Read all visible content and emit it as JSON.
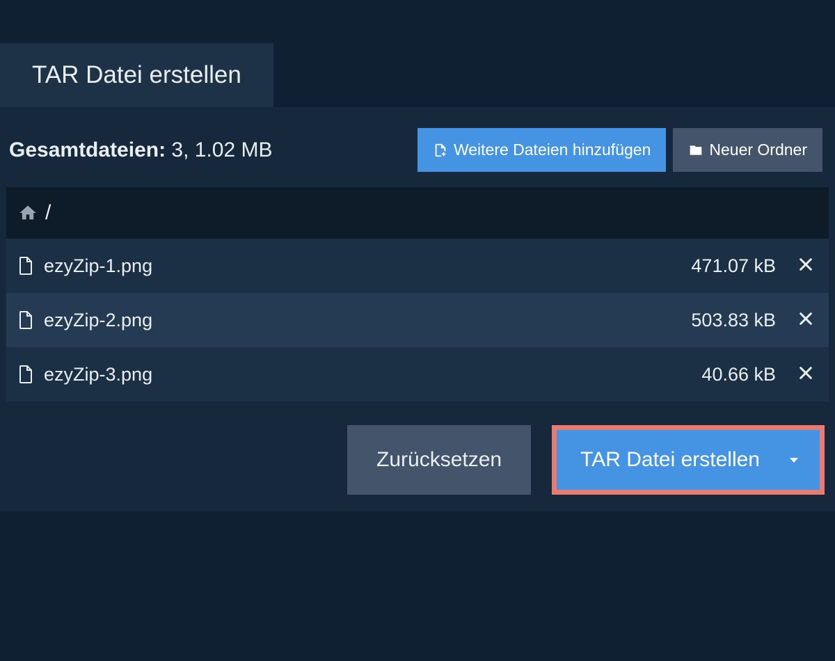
{
  "tab": {
    "title": "TAR Datei erstellen"
  },
  "summary": {
    "label": "Gesamtdateien:",
    "value": "3, 1.02 MB"
  },
  "toolbar": {
    "add_files_label": "Weitere Dateien hinzufügen",
    "new_folder_label": "Neuer Ordner"
  },
  "breadcrumb": {
    "path": "/"
  },
  "files": [
    {
      "name": "ezyZip-1.png",
      "size": "471.07 kB"
    },
    {
      "name": "ezyZip-2.png",
      "size": "503.83 kB"
    },
    {
      "name": "ezyZip-3.png",
      "size": "40.66 kB"
    }
  ],
  "actions": {
    "reset_label": "Zurücksetzen",
    "create_label": "TAR Datei erstellen"
  }
}
